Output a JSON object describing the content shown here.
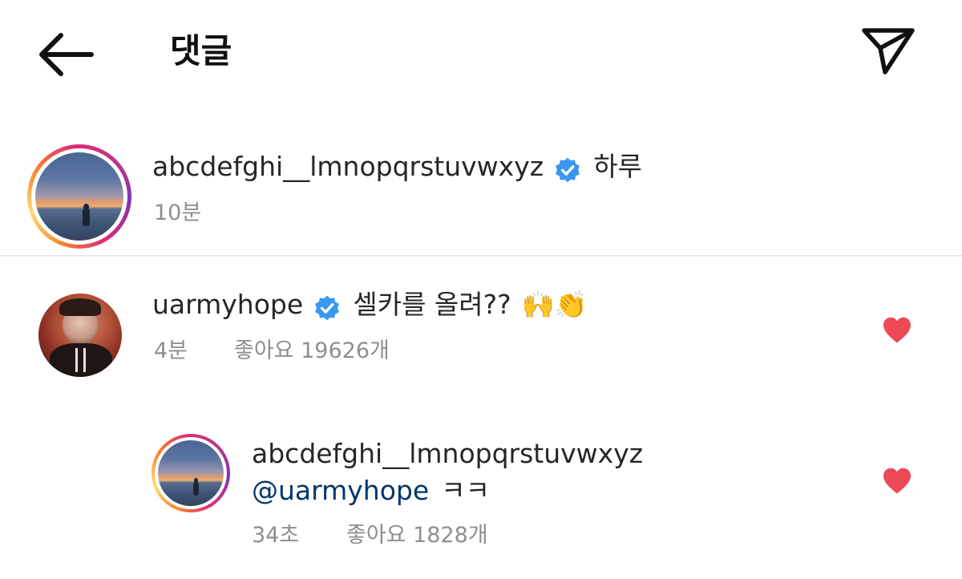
{
  "header": {
    "title": "댓글",
    "back_icon": "arrow-left-icon",
    "send_icon": "paper-plane-icon"
  },
  "caption": {
    "username": "abcdefghi__lmnopqrstuvwxyz",
    "verified": true,
    "text": "하루",
    "time": "10분"
  },
  "comments": [
    {
      "username": "uarmyhope",
      "verified": true,
      "text": "셀카를 올려??",
      "emoji": "🙌👏",
      "time": "4분",
      "likes": "좋아요 19626개",
      "liked": true
    },
    {
      "username": "abcdefghi__lmnopqrstuvwxyz",
      "mention": "@uarmyhope",
      "text": "ㅋㅋ",
      "time": "34초",
      "likes": "좋아요 1828개",
      "liked": true
    }
  ],
  "colors": {
    "heart": "#ed4956",
    "verified": "#3897f0",
    "mention": "#00376b",
    "meta": "#8e8e8e"
  }
}
